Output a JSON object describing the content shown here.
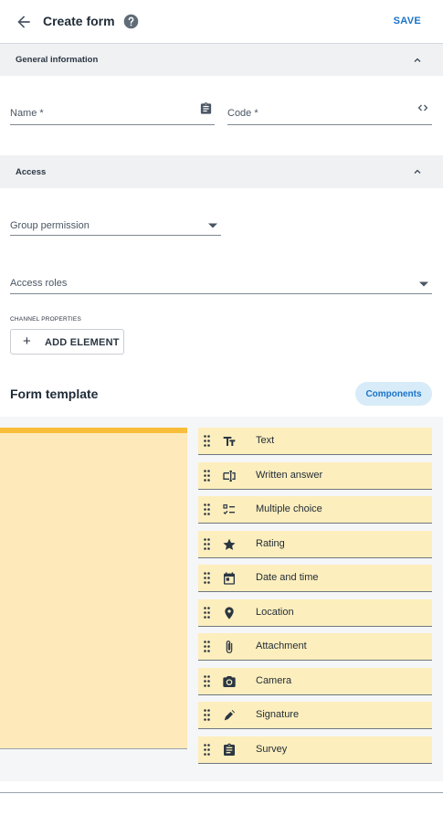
{
  "header": {
    "title": "Create form",
    "save_label": "SAVE",
    "back_icon": "arrow-left-icon",
    "help_icon": "help-icon"
  },
  "general": {
    "title": "General information",
    "name_label": "Name *",
    "code_label": "Code *"
  },
  "access": {
    "title": "Access",
    "group_permission_label": "Group permission",
    "access_roles_label": "Access roles"
  },
  "channel": {
    "label": "CHANNEL PROPERTIES",
    "add_label": "ADD ELEMENT"
  },
  "template": {
    "title": "Form template",
    "components_label": "Components",
    "colors": {
      "canvas": "#fde9b9",
      "canvas_border": "#f8bd39",
      "item": "#fdeebd",
      "accent": "#1a73c9"
    },
    "items": [
      {
        "label": "Text",
        "icon": "text-format-icon"
      },
      {
        "label": "Written answer",
        "icon": "input-field-icon"
      },
      {
        "label": "Multiple choice",
        "icon": "checklist-icon"
      },
      {
        "label": "Rating",
        "icon": "star-icon"
      },
      {
        "label": "Date and time",
        "icon": "calendar-icon"
      },
      {
        "label": "Location",
        "icon": "location-pin-icon"
      },
      {
        "label": "Attachment",
        "icon": "paperclip-icon"
      },
      {
        "label": "Camera",
        "icon": "camera-icon"
      },
      {
        "label": "Signature",
        "icon": "pen-icon"
      },
      {
        "label": "Survey",
        "icon": "clipboard-icon"
      }
    ]
  }
}
